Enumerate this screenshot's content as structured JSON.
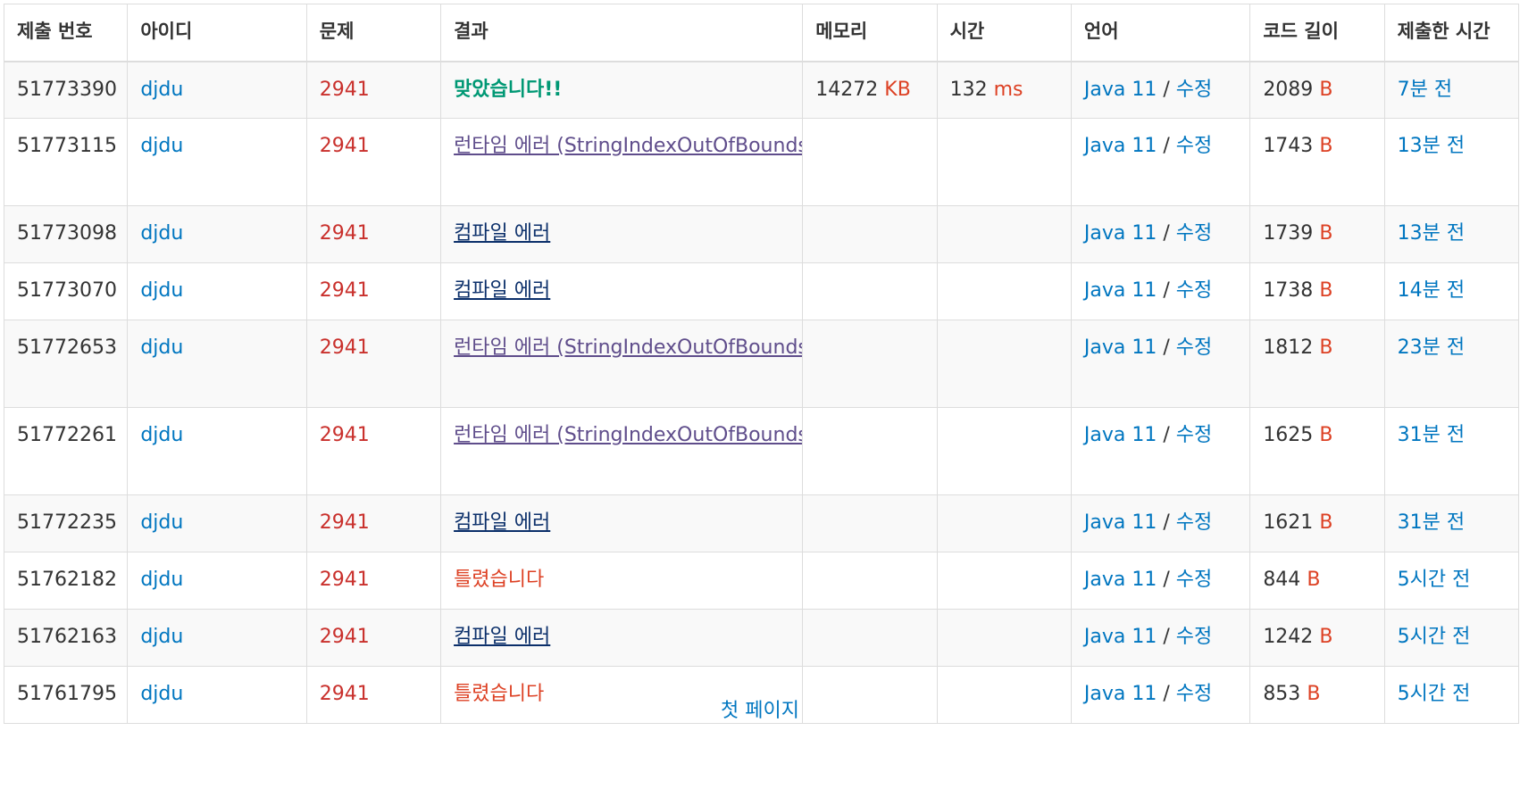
{
  "headers": [
    "제출 번호",
    "아이디",
    "문제",
    "결과",
    "메모리",
    "시간",
    "언어",
    "코드 길이",
    "제출한 시간"
  ],
  "colors": {
    "link": "#0076c0",
    "problem": "#c9302c",
    "accepted": "#009874",
    "runtime_error": "#5f4d8b",
    "compile_error": "#0b2f6a",
    "wrong": "#dd4124"
  },
  "rows": [
    {
      "id": "51773390",
      "user": "djdu",
      "problem": "2941",
      "result_type": "ac",
      "result": "맞았습니다!!",
      "memory": "14272",
      "memory_unit": "KB",
      "time": "132",
      "time_unit": "ms",
      "lang": "Java 11",
      "sep": "/",
      "edit": "수정",
      "code_len": "2089",
      "code_unit": "B",
      "submitted": "7분 전"
    },
    {
      "id": "51773115",
      "user": "djdu",
      "problem": "2941",
      "result_type": "rte",
      "result": "런타임 에러 (StringIndexOutOfBounds)",
      "memory": "",
      "memory_unit": "",
      "time": "",
      "time_unit": "",
      "lang": "Java 11",
      "sep": "/",
      "edit": "수정",
      "code_len": "1743",
      "code_unit": "B",
      "submitted": "13분 전"
    },
    {
      "id": "51773098",
      "user": "djdu",
      "problem": "2941",
      "result_type": "ce",
      "result": "컴파일 에러",
      "memory": "",
      "memory_unit": "",
      "time": "",
      "time_unit": "",
      "lang": "Java 11",
      "sep": "/",
      "edit": "수정",
      "code_len": "1739",
      "code_unit": "B",
      "submitted": "13분 전"
    },
    {
      "id": "51773070",
      "user": "djdu",
      "problem": "2941",
      "result_type": "ce",
      "result": "컴파일 에러",
      "memory": "",
      "memory_unit": "",
      "time": "",
      "time_unit": "",
      "lang": "Java 11",
      "sep": "/",
      "edit": "수정",
      "code_len": "1738",
      "code_unit": "B",
      "submitted": "14분 전"
    },
    {
      "id": "51772653",
      "user": "djdu",
      "problem": "2941",
      "result_type": "rte",
      "result": "런타임 에러 (StringIndexOutOfBounds)",
      "memory": "",
      "memory_unit": "",
      "time": "",
      "time_unit": "",
      "lang": "Java 11",
      "sep": "/",
      "edit": "수정",
      "code_len": "1812",
      "code_unit": "B",
      "submitted": "23분 전"
    },
    {
      "id": "51772261",
      "user": "djdu",
      "problem": "2941",
      "result_type": "rte",
      "result": "런타임 에러 (StringIndexOutOfBounds)",
      "memory": "",
      "memory_unit": "",
      "time": "",
      "time_unit": "",
      "lang": "Java 11",
      "sep": "/",
      "edit": "수정",
      "code_len": "1625",
      "code_unit": "B",
      "submitted": "31분 전"
    },
    {
      "id": "51772235",
      "user": "djdu",
      "problem": "2941",
      "result_type": "ce",
      "result": "컴파일 에러",
      "memory": "",
      "memory_unit": "",
      "time": "",
      "time_unit": "",
      "lang": "Java 11",
      "sep": "/",
      "edit": "수정",
      "code_len": "1621",
      "code_unit": "B",
      "submitted": "31분 전"
    },
    {
      "id": "51762182",
      "user": "djdu",
      "problem": "2941",
      "result_type": "wa",
      "result": "틀렸습니다",
      "memory": "",
      "memory_unit": "",
      "time": "",
      "time_unit": "",
      "lang": "Java 11",
      "sep": "/",
      "edit": "수정",
      "code_len": "844",
      "code_unit": "B",
      "submitted": "5시간 전"
    },
    {
      "id": "51762163",
      "user": "djdu",
      "problem": "2941",
      "result_type": "ce",
      "result": "컴파일 에러",
      "memory": "",
      "memory_unit": "",
      "time": "",
      "time_unit": "",
      "lang": "Java 11",
      "sep": "/",
      "edit": "수정",
      "code_len": "1242",
      "code_unit": "B",
      "submitted": "5시간 전"
    },
    {
      "id": "51761795",
      "user": "djdu",
      "problem": "2941",
      "result_type": "wa",
      "result": "틀렸습니다",
      "memory": "",
      "memory_unit": "",
      "time": "",
      "time_unit": "",
      "lang": "Java 11",
      "sep": "/",
      "edit": "수정",
      "code_len": "853",
      "code_unit": "B",
      "submitted": "5시간 전"
    }
  ],
  "pagination": {
    "first_page": "첫 페이지"
  }
}
